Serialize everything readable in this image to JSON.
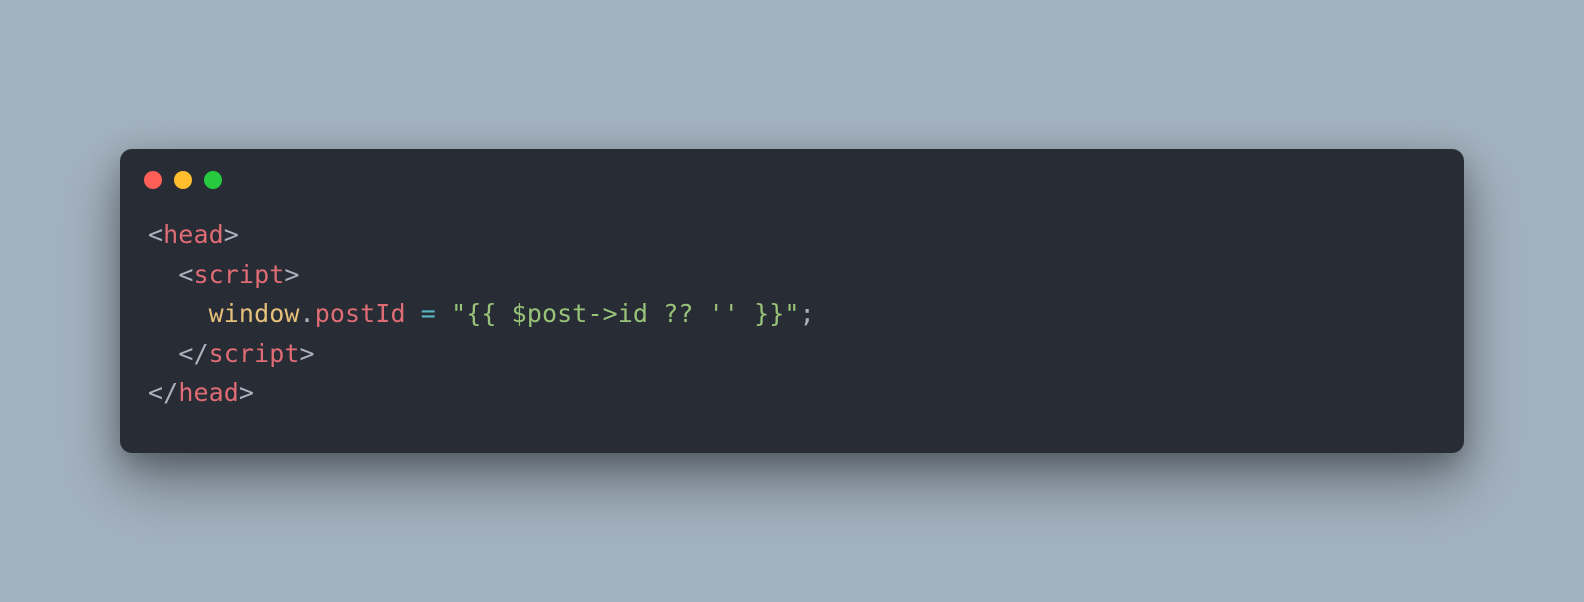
{
  "traffic_lights": {
    "close_color": "#ff5f56",
    "minimize_color": "#ffbd2e",
    "maximize_color": "#27c93f"
  },
  "code": {
    "line1": {
      "open_bracket": "<",
      "tag": "head",
      "close_bracket": ">"
    },
    "line2": {
      "indent": "  ",
      "open_bracket": "<",
      "tag": "script",
      "close_bracket": ">"
    },
    "line3": {
      "indent": "    ",
      "obj": "window",
      "dot": ".",
      "prop": "postId",
      "space_eq": " ",
      "eq": "=",
      "space_after_eq": " ",
      "str": "\"{{ $post->id ?? '' }}\"",
      "semi": ";"
    },
    "line4": {
      "indent": "  ",
      "open_bracket": "</",
      "tag": "script",
      "close_bracket": ">"
    },
    "line5": {
      "open_bracket": "</",
      "tag": "head",
      "close_bracket": ">"
    }
  }
}
